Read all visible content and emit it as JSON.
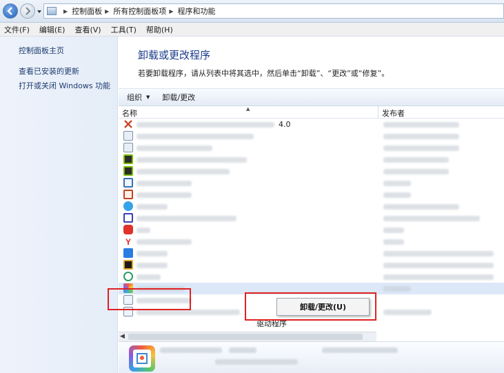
{
  "address": {
    "crumbs": [
      "控制面板",
      "所有控制面板项",
      "程序和功能"
    ]
  },
  "menu": [
    "文件(F)",
    "编辑(E)",
    "查看(V)",
    "工具(T)",
    "帮助(H)"
  ],
  "sidebar": {
    "items": [
      "控制面板主页",
      "查看已安装的更新",
      "打开或关闭 Windows 功能"
    ]
  },
  "main": {
    "title": "卸载或更改程序",
    "description": "若要卸载程序，请从列表中将其选中，然后单击“卸载”、“更改”或“修复”。"
  },
  "toolbar": {
    "organize": "组织",
    "uninstall_change": "卸载/更改"
  },
  "columns": {
    "name": "名称",
    "publisher": "发布者"
  },
  "rows": {
    "first_version": "4.0",
    "driver_suffix": "驱动程序"
  },
  "context_menu": {
    "label": "卸载/更改(U)"
  },
  "colors": {
    "link": "#1c3a6e",
    "title": "#1a3a8a",
    "highlight": "#e02020",
    "selection": "#dce8f8"
  }
}
